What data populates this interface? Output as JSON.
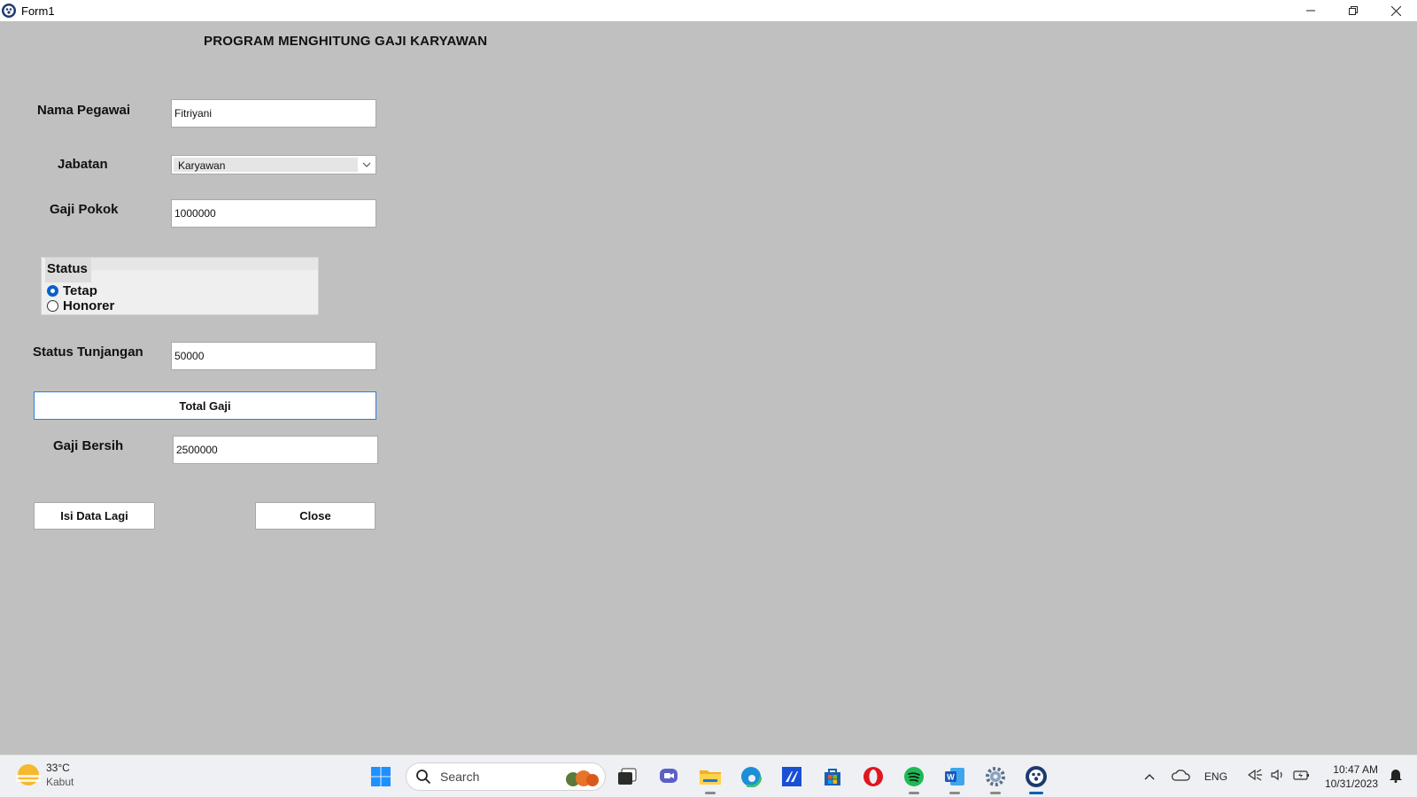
{
  "window": {
    "title": "Form1"
  },
  "form": {
    "heading": "PROGRAM MENGHITUNG GAJI KARYAWAN",
    "nama_label": "Nama Pegawai",
    "nama_value": "Fitriyani",
    "jabatan_label": "Jabatan",
    "jabatan_value": "Karyawan",
    "gaji_pokok_label": "Gaji Pokok",
    "gaji_pokok_value": "1000000",
    "status_group": {
      "legend": "Status",
      "options": [
        {
          "label": "Tetap",
          "checked": true
        },
        {
          "label": "Honorer",
          "checked": false
        }
      ]
    },
    "tunjangan_label": "Status Tunjangan",
    "tunjangan_value": "50000",
    "total_button": "Total Gaji",
    "gaji_bersih_label": "Gaji Bersih",
    "gaji_bersih_value": "2500000",
    "isi_button": "Isi Data Lagi",
    "close_button": "Close"
  },
  "taskbar": {
    "weather_temp": "33°C",
    "weather_cond": "Kabut",
    "search_placeholder": "Search",
    "language": "ENG",
    "time": "10:47 AM",
    "date": "10/31/2023",
    "icons": [
      "windows-start-icon",
      "search-icon",
      "task-view-icon",
      "teams-chat-icon",
      "file-explorer-icon",
      "edge-browser-icon",
      "visual-studio-icon",
      "microsoft-store-icon",
      "opera-browser-icon",
      "spotify-icon",
      "word-icon",
      "settings-icon",
      "form-app-icon"
    ]
  },
  "colors": {
    "form_bg": "#c0c0c0",
    "accent": "#0a5fcb",
    "taskbar_bg": "#eef0f3"
  }
}
